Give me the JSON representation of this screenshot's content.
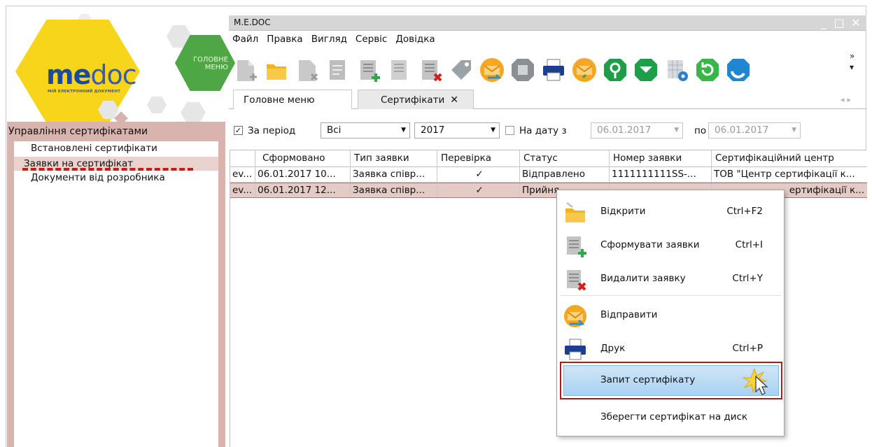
{
  "logo": {
    "brand_me": "me",
    "brand_doc": "doc",
    "subtitle": "МІЙ ЕЛЕКТРОННИЙ ДОКУМЕНТ",
    "main_menu_line1": "ГОЛОВНЕ",
    "main_menu_line2": "МЕНЮ"
  },
  "sidebar": {
    "title": "Управління сертифікатами",
    "items": [
      {
        "label": "Встановлені сертифікати"
      },
      {
        "label": "Заявки на сертифікат"
      },
      {
        "label": "Документи від розробника"
      }
    ]
  },
  "window": {
    "title": "M.E.DOC",
    "minimize": "_",
    "maximize": "□",
    "close": "✕"
  },
  "menubar": {
    "items": [
      "Файл",
      "Правка",
      "Вигляд",
      "Сервіс",
      "Довідка"
    ]
  },
  "toolbar": {
    "overflow": "»"
  },
  "tabs": [
    {
      "label": "Головне меню"
    },
    {
      "label": "Сертифікати",
      "close": "✕"
    }
  ],
  "filter": {
    "period_checked": true,
    "period_label": "За період",
    "type_value": "Всі",
    "year_value": "2017",
    "date_checked": false,
    "date_label": "На дату з",
    "date_from": "06.01.2017",
    "to_label": "по",
    "date_to": "06.01.2017"
  },
  "grid": {
    "columns": [
      "",
      "Сформовано",
      "Тип заявки",
      "Перевірка",
      "Статус",
      "Номер заявки",
      "Сертифікаційний центр"
    ],
    "rows": [
      [
        "ev...",
        "06.01.2017 10...",
        "Заявка співр...",
        "✓",
        "Відправлено",
        "1111111111SS-...",
        "ТОВ \"Центр сертифікації к..."
      ],
      [
        "ev...",
        "06.01.2017 12...",
        "Заявка співр...",
        "✓",
        "Прийня",
        "",
        "ертифікації к..."
      ]
    ]
  },
  "context_menu": {
    "items": [
      {
        "label": "Відкрити",
        "shortcut": "Ctrl+F2"
      },
      {
        "label": "Сформувати заявки",
        "shortcut": "Ctrl+I"
      },
      {
        "label": "Видалити заявку",
        "shortcut": "Ctrl+Y"
      },
      {
        "label": "Відправити",
        "shortcut": ""
      },
      {
        "label": "Друк",
        "shortcut": "Ctrl+P"
      },
      {
        "label": "Запит сертифікату",
        "shortcut": ""
      },
      {
        "label": "Зберегти сертифікат на диск",
        "shortcut": ""
      }
    ]
  },
  "colors": {
    "accent_panel": "#d9b4ae",
    "brand_yellow": "#f7d51a",
    "brand_green": "#4ea645",
    "highlight_border": "#a51d1d",
    "annotation_red": "#cc1a1a"
  }
}
